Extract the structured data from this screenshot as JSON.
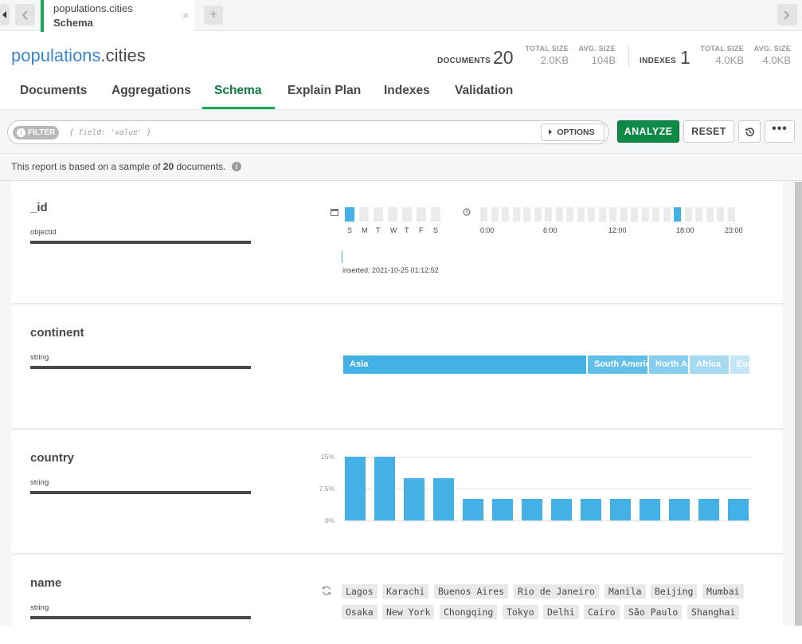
{
  "tabbar": {
    "back_icon": "chevron-left-icon",
    "forward_icon": "chevron-right-icon",
    "active_tab": {
      "namespace": "populations.cities",
      "subtitle": "Schema",
      "close": "×"
    },
    "new_tab": "+"
  },
  "header": {
    "db": "populations",
    "collection": ".cities",
    "documents": {
      "label": "DOCUMENTS",
      "count": "20",
      "total_size_label": "TOTAL SIZE",
      "total_size": "2.0KB",
      "avg_size_label": "AVG. SIZE",
      "avg_size": "104B"
    },
    "indexes": {
      "label": "INDEXES",
      "count": "1",
      "total_size_label": "TOTAL SIZE",
      "total_size": "4.0KB",
      "avg_size_label": "AVG. SIZE",
      "avg_size": "4.0KB"
    }
  },
  "subtabs": [
    "Documents",
    "Aggregations",
    "Schema",
    "Explain Plan",
    "Indexes",
    "Validation"
  ],
  "active_subtab": "Schema",
  "querybar": {
    "filter_label": "FILTER",
    "filter_placeholder": "{ field: 'value' }",
    "options_label": "OPTIONS",
    "analyze_label": "ANALYZE",
    "reset_label": "RESET",
    "history_icon": "history-icon",
    "more_label": "•••"
  },
  "sample": {
    "prefix": "This report is based on a sample of ",
    "count": "20",
    "suffix": " documents.",
    "info_icon": "info-icon"
  },
  "fields": {
    "id": {
      "name": "_id",
      "type": "objectid",
      "calendar_icon": "calendar-icon",
      "clock_icon": "clock-icon",
      "days": [
        "S",
        "M",
        "T",
        "W",
        "T",
        "F",
        "S"
      ],
      "active_day_index": 0,
      "hour_labels": [
        "0:00",
        "6:00",
        "12:00",
        "18:00",
        "23:00"
      ],
      "active_hour_index": 18,
      "inserted": "inserted: 2021-10-25 01:12:52"
    },
    "continent": {
      "name": "continent",
      "type": "string",
      "segments": [
        {
          "label": "Asia",
          "share": 0.6,
          "color": "#43b1e5"
        },
        {
          "label": "South America",
          "share": 0.15,
          "color": "#62bfea"
        },
        {
          "label": "North America",
          "share": 0.1,
          "color": "#86cdef"
        },
        {
          "label": "Africa",
          "share": 0.1,
          "color": "#a6daf3"
        },
        {
          "label": "Europe",
          "share": 0.05,
          "color": "#c4e6f7"
        }
      ]
    },
    "country": {
      "name": "country",
      "type": "string",
      "y_labels": [
        "15%",
        "7.5%",
        "0%"
      ]
    },
    "name": {
      "name": "name",
      "type": "string",
      "refresh_icon": "refresh-icon",
      "values_row1": [
        "Lagos",
        "Karachi",
        "Buenos Aires",
        "Rio de Janeiro",
        "Manila",
        "Beijing",
        "Mumbai"
      ],
      "values_row2": [
        "Osaka",
        "New York",
        "Chongqing",
        "Tokyo",
        "Delhi",
        "Cairo",
        "São Paulo",
        "Shanghai"
      ]
    }
  },
  "chart_data": {
    "type": "bar",
    "ylabel": "",
    "ylim": [
      0,
      15
    ],
    "y_ticks": [
      "0%",
      "7.5%",
      "15%"
    ],
    "series": [
      {
        "values": [
          15,
          15,
          10,
          10,
          5,
          5,
          5,
          5,
          5,
          5,
          5,
          5,
          5,
          5
        ]
      }
    ],
    "grid": true
  }
}
